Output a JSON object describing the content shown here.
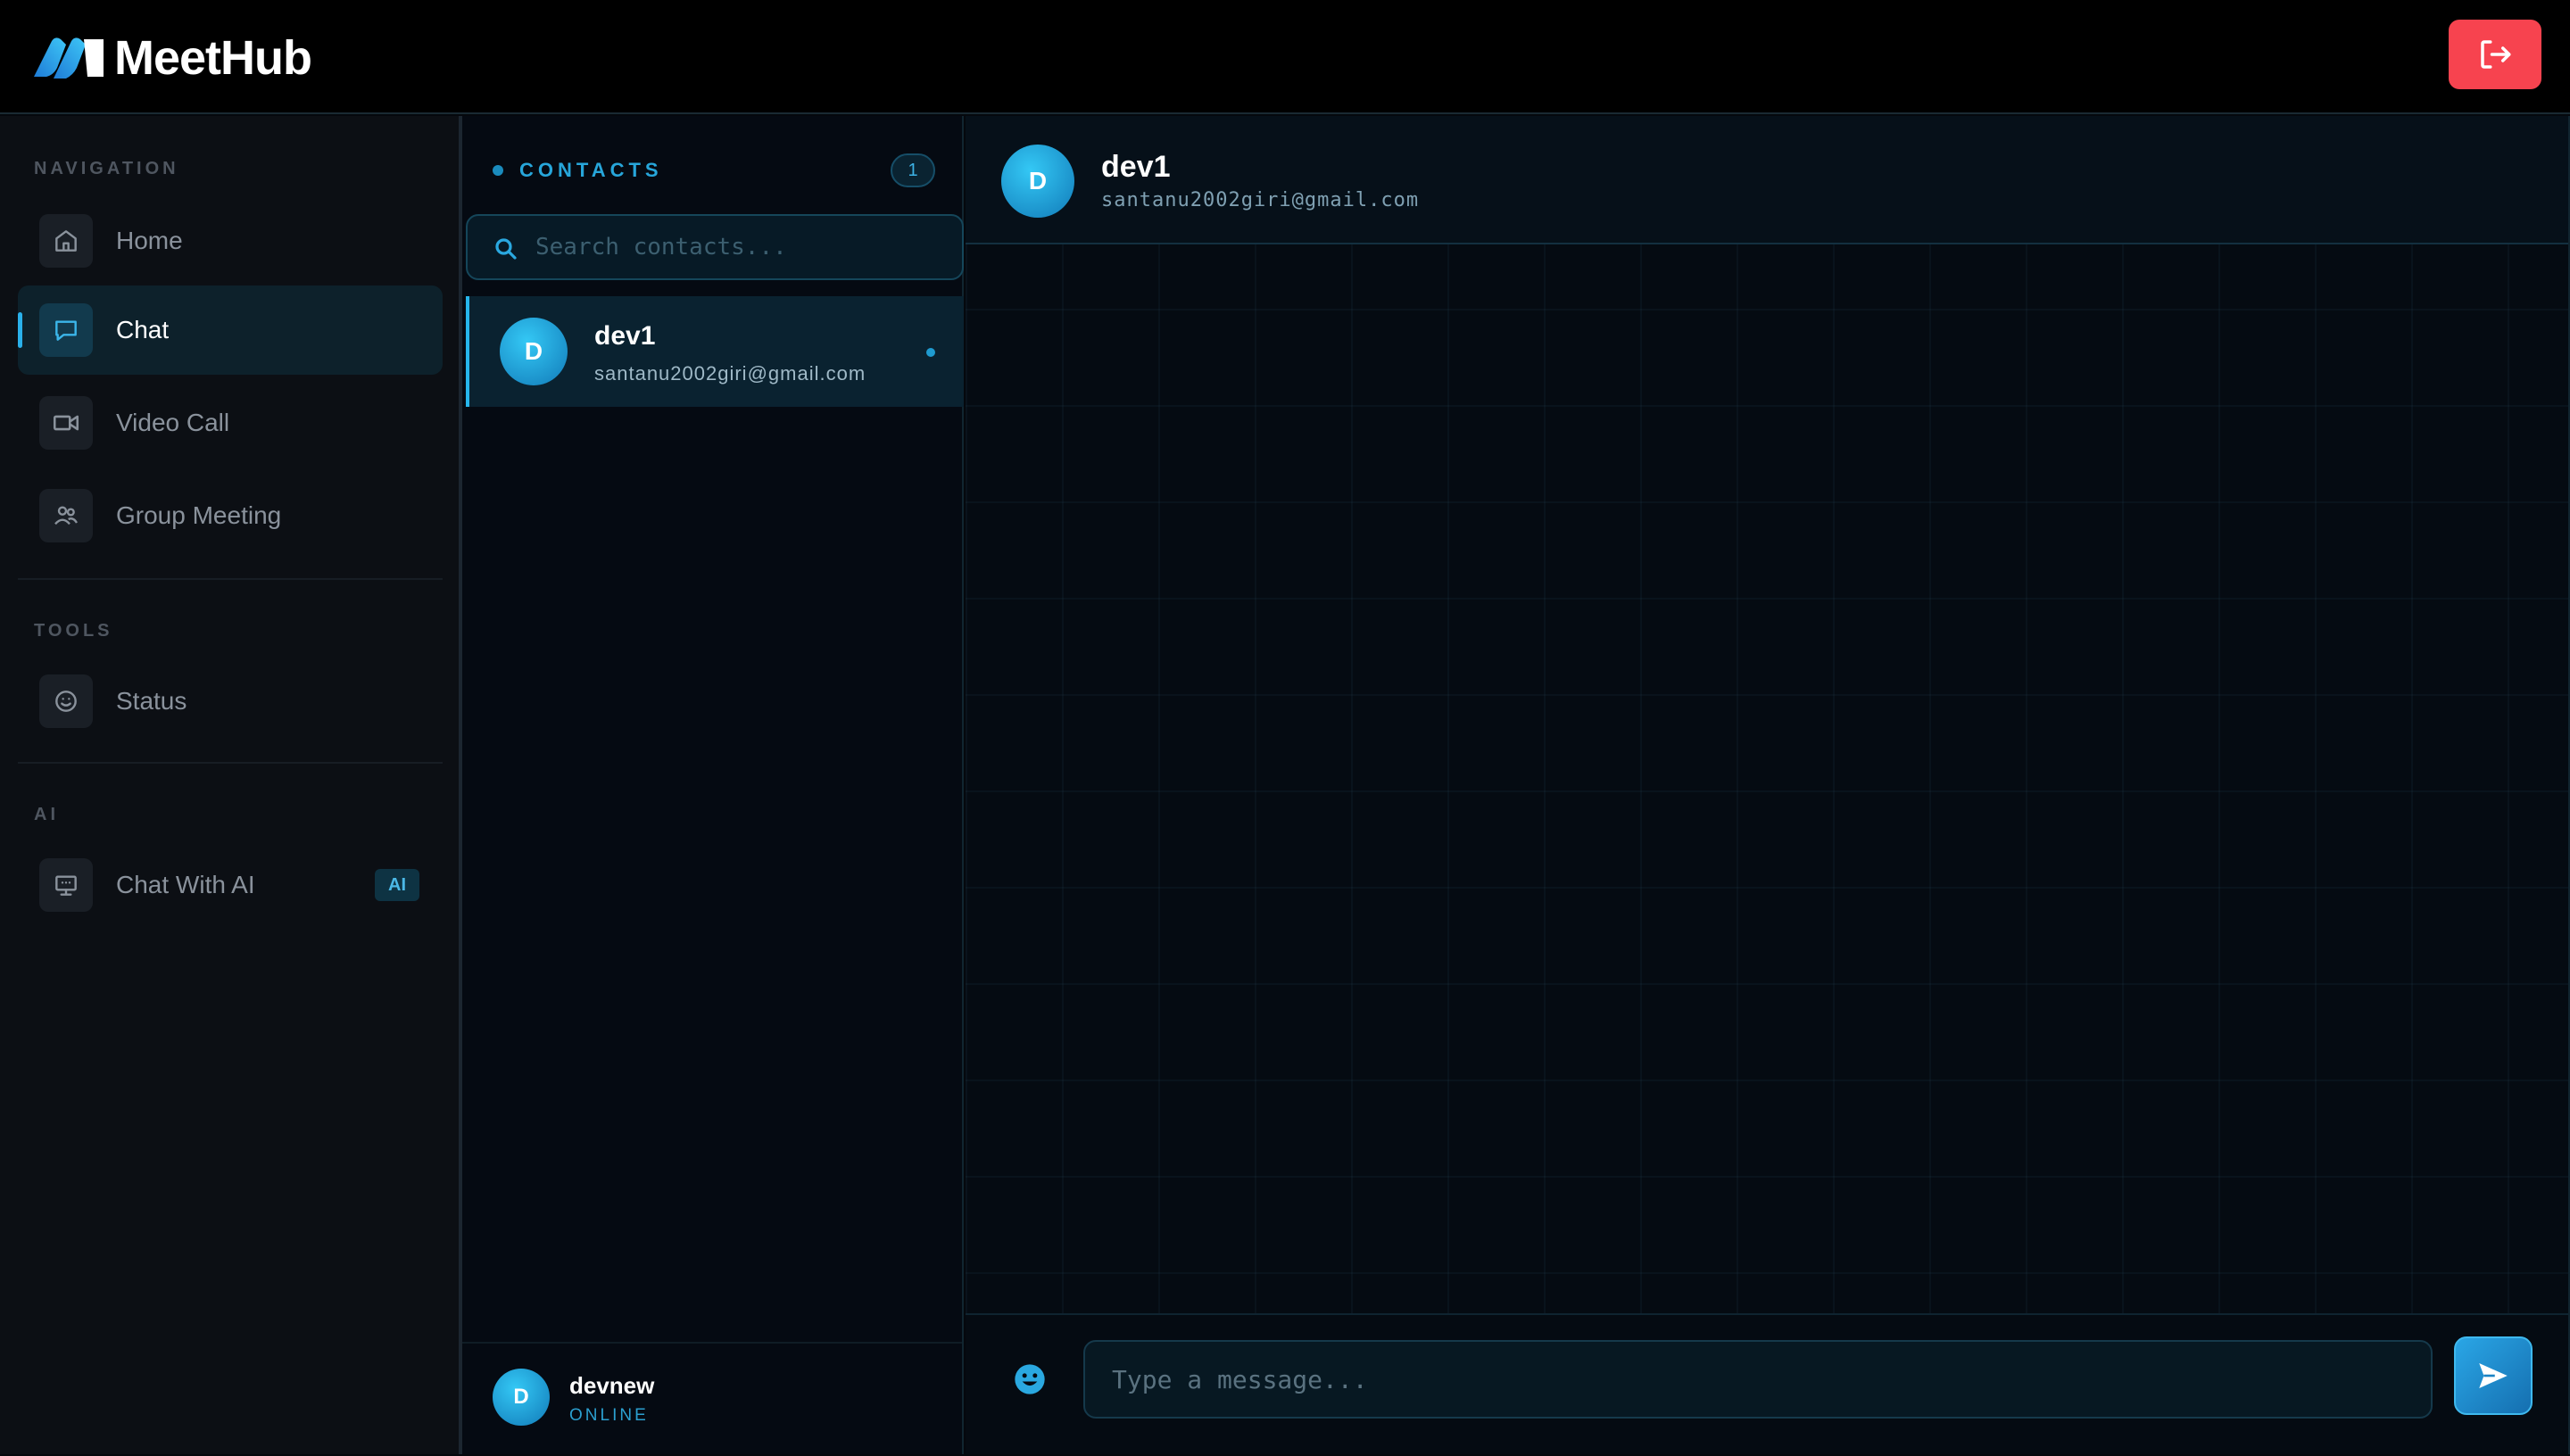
{
  "app": {
    "name": "MeetHub"
  },
  "colors": {
    "accent": "#26b6ec",
    "logout": "#f7434f"
  },
  "sidebar": {
    "sections": [
      {
        "label": "NAVIGATION",
        "items": [
          {
            "label": "Home",
            "icon": "home-icon",
            "active": false
          },
          {
            "label": "Chat",
            "icon": "chat-icon",
            "active": true
          },
          {
            "label": "Video Call",
            "icon": "video-icon",
            "active": false
          },
          {
            "label": "Group Meeting",
            "icon": "group-icon",
            "active": false
          }
        ]
      },
      {
        "label": "TOOLS",
        "items": [
          {
            "label": "Status",
            "icon": "smiley-icon",
            "active": false
          }
        ]
      },
      {
        "label": "AI",
        "items": [
          {
            "label": "Chat With AI",
            "icon": "monitor-icon",
            "active": false,
            "badge": "AI"
          }
        ]
      }
    ]
  },
  "contacts": {
    "title": "CONTACTS",
    "count": "1",
    "search_placeholder": "Search contacts...",
    "items": [
      {
        "initial": "D",
        "name": "dev1",
        "email": "santanu2002giri@gmail.com",
        "online": true
      }
    ],
    "me": {
      "initial": "D",
      "name": "devnew",
      "status": "ONLINE"
    }
  },
  "chat": {
    "header": {
      "initial": "D",
      "name": "dev1",
      "email": "santanu2002giri@gmail.com"
    },
    "message_placeholder": "Type a message..."
  }
}
